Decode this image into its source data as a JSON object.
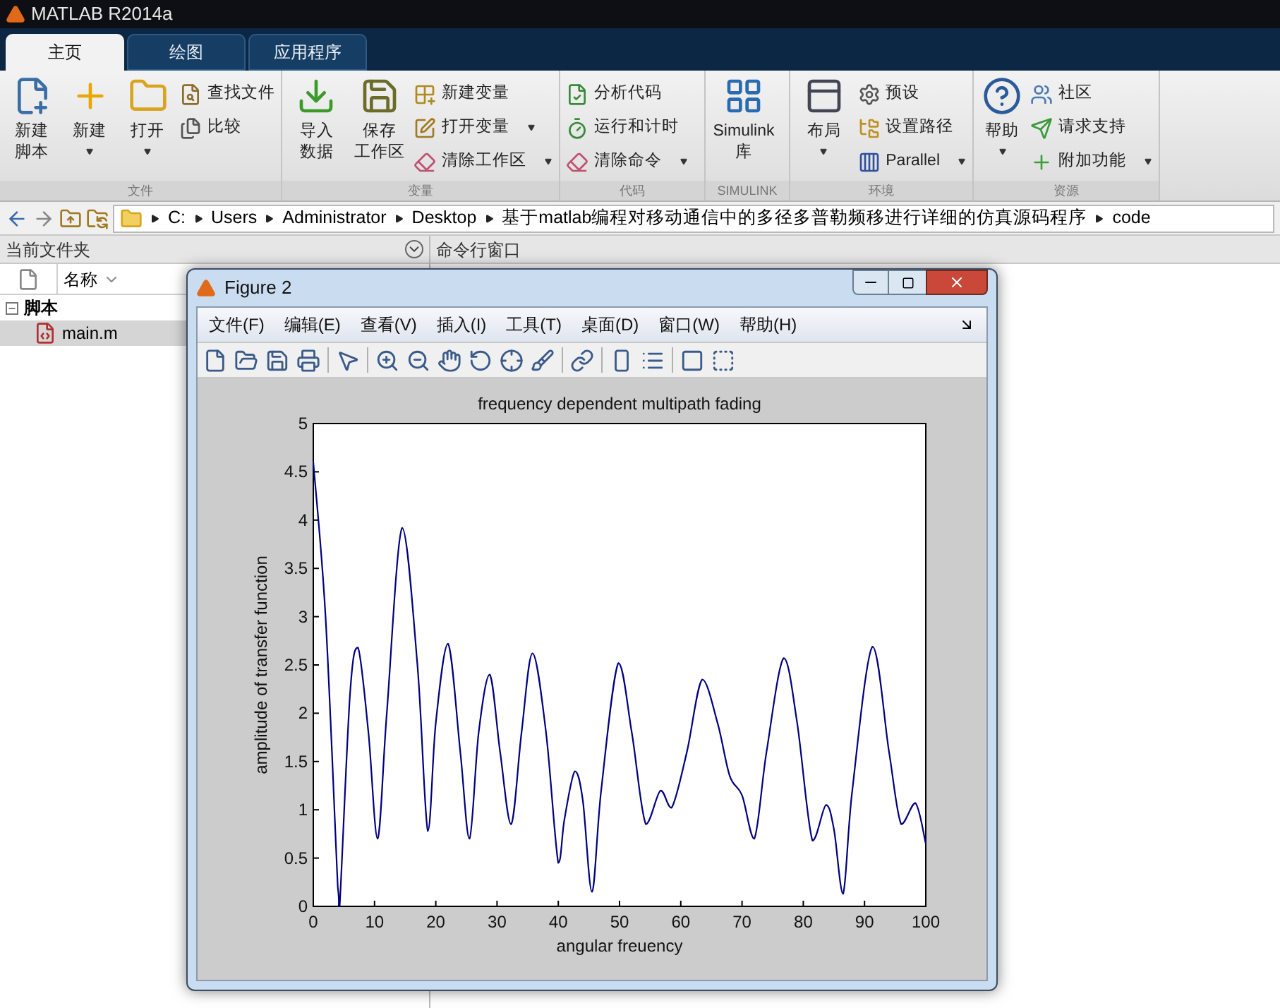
{
  "window": {
    "title": "MATLAB R2014a"
  },
  "tabs": [
    {
      "label": "主页",
      "selected": true
    },
    {
      "label": "绘图",
      "selected": false
    },
    {
      "label": "应用程序",
      "selected": false
    }
  ],
  "ribbon": {
    "groups": [
      {
        "label": "文件",
        "items": [
          {
            "kind": "large",
            "lines": [
              "新建",
              "脚本"
            ],
            "dropdown": false
          },
          {
            "kind": "large",
            "lines": [
              "新建"
            ],
            "dropdown": true
          },
          {
            "kind": "large",
            "lines": [
              "打开"
            ],
            "dropdown": true
          },
          {
            "kind": "small",
            "lines": [
              "查找文件"
            ],
            "dropdown": false
          },
          {
            "kind": "small",
            "lines": [
              "比较"
            ],
            "dropdown": false
          }
        ]
      },
      {
        "label": "变量",
        "items": [
          {
            "kind": "large",
            "lines": [
              "导入",
              "数据"
            ],
            "dropdown": false
          },
          {
            "kind": "large",
            "lines": [
              "保存",
              "工作区"
            ],
            "dropdown": false
          },
          {
            "kind": "small",
            "lines": [
              "新建变量"
            ],
            "dropdown": false
          },
          {
            "kind": "small",
            "lines": [
              "打开变量"
            ],
            "dropdown": true
          },
          {
            "kind": "small",
            "lines": [
              "清除工作区"
            ],
            "dropdown": true
          }
        ]
      },
      {
        "label": "代码",
        "items": [
          {
            "kind": "small",
            "lines": [
              "分析代码"
            ],
            "dropdown": false
          },
          {
            "kind": "small",
            "lines": [
              "运行和计时"
            ],
            "dropdown": false
          },
          {
            "kind": "small",
            "lines": [
              "清除命令"
            ],
            "dropdown": true
          }
        ]
      },
      {
        "label": "SIMULINK",
        "items": [
          {
            "kind": "large",
            "lines": [
              "Simulink",
              "库"
            ],
            "dropdown": false
          }
        ]
      },
      {
        "label": "环境",
        "items": [
          {
            "kind": "large",
            "lines": [
              "布局"
            ],
            "dropdown": true
          },
          {
            "kind": "small",
            "lines": [
              "预设"
            ],
            "dropdown": false
          },
          {
            "kind": "small",
            "lines": [
              "设置路径"
            ],
            "dropdown": false
          },
          {
            "kind": "small",
            "lines": [
              "Parallel"
            ],
            "dropdown": true
          }
        ]
      },
      {
        "label": "资源",
        "items": [
          {
            "kind": "large",
            "lines": [
              "帮助"
            ],
            "dropdown": true
          },
          {
            "kind": "small",
            "lines": [
              "社区"
            ],
            "dropdown": false
          },
          {
            "kind": "small",
            "lines": [
              "请求支持"
            ],
            "dropdown": false
          },
          {
            "kind": "small",
            "lines": [
              "附加功能"
            ],
            "dropdown": true
          }
        ]
      }
    ]
  },
  "address_bar": {
    "path": [
      "C:",
      "Users",
      "Administrator",
      "Desktop",
      "基于matlab编程对移动通信中的多径多普勒频移进行详细的仿真源码程序",
      "code"
    ]
  },
  "current_folder": {
    "title": "当前文件夹",
    "column": "名称",
    "tree": [
      {
        "label": "脚本",
        "expanded": true,
        "children": [
          {
            "label": "main.m",
            "selected": true
          }
        ]
      }
    ]
  },
  "command_window": {
    "title": "命令行窗口"
  },
  "figure": {
    "title": "Figure 2",
    "menu": [
      "文件(F)",
      "编辑(E)",
      "查看(V)",
      "插入(I)",
      "工具(T)",
      "桌面(D)",
      "窗口(W)",
      "帮助(H)"
    ],
    "chart_data": {
      "type": "line",
      "title": "frequency dependent multipath fading",
      "xlabel": "angular freuency",
      "ylabel": "amplitude of transfer function",
      "x": [
        0,
        2,
        4,
        4.3,
        6,
        7.3,
        9,
        10.5,
        12,
        14.5,
        17,
        18.7,
        20,
        22,
        24,
        25.5,
        27,
        28.8,
        30.5,
        32.3,
        34,
        35.8,
        38,
        40,
        41,
        42.7,
        44,
        45.5,
        47,
        49.8,
        52,
        54.3,
        56.7,
        58.5,
        61,
        63.5,
        66,
        68,
        70,
        72,
        74,
        76.8,
        79,
        81.5,
        83.7,
        85,
        86.5,
        88,
        91.3,
        94,
        96,
        98.3,
        100
      ],
      "series": [
        {
          "color": "#000080",
          "values": [
            4.6,
            3.0,
            0.2,
            0,
            2.2,
            2.68,
            1.8,
            0.7,
            2.0,
            3.92,
            2.5,
            0.78,
            1.9,
            2.72,
            1.6,
            0.7,
            1.8,
            2.4,
            1.6,
            0.85,
            1.8,
            2.62,
            1.8,
            0.45,
            0.9,
            1.4,
            1.1,
            0.15,
            1.2,
            2.52,
            1.8,
            0.85,
            1.2,
            1.02,
            1.6,
            2.35,
            1.9,
            1.35,
            1.15,
            0.7,
            1.6,
            2.57,
            1.9,
            0.68,
            1.05,
            0.8,
            0.13,
            1.2,
            2.69,
            1.6,
            0.85,
            1.07,
            0.65
          ]
        }
      ],
      "xlim": [
        0,
        100
      ],
      "ylim": [
        0,
        5
      ],
      "xticks": [
        0,
        10,
        20,
        30,
        40,
        50,
        60,
        70,
        80,
        90,
        100
      ],
      "yticks": [
        0,
        0.5,
        1,
        1.5,
        2,
        2.5,
        3,
        3.5,
        4,
        4.5,
        5
      ]
    }
  }
}
